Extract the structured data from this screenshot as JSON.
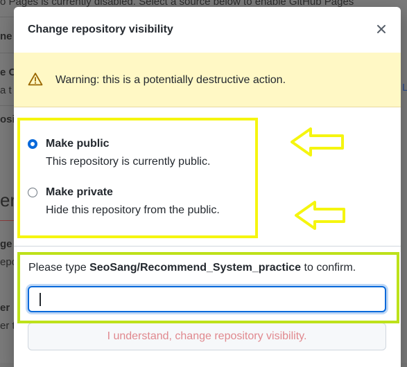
{
  "background": {
    "line1": "o Pages is currently disabled. Select a source below to enable GitHub Pages",
    "frag_a": "ne",
    "frag_b": "e C",
    "frag_c": "a t",
    "frag_d": "osi",
    "frag_e": "er",
    "frag_f": "ge r",
    "frag_g": "epo",
    "frag_h": "er",
    "frag_i": "er t",
    "right_frag": "L"
  },
  "modal": {
    "title": "Change repository visibility",
    "warning": "Warning: this is a potentially destructive action.",
    "options": [
      {
        "label": "Make public",
        "description": "This repository is currently public.",
        "checked": true
      },
      {
        "label": "Make private",
        "description": "Hide this repository from the public.",
        "checked": false
      }
    ],
    "confirm_prefix": "Please type ",
    "confirm_repo": "SeoSang/Recommend_System_practice",
    "confirm_suffix": " to confirm.",
    "input_value": "",
    "submit_label": "I understand, change repository visibility."
  },
  "colors": {
    "accent": "#0969da",
    "warning_bg": "#fff8c5",
    "highlight_yellow": "#f5f50f",
    "highlight_green": "#bde11a",
    "danger_disabled": "#e0888e"
  }
}
